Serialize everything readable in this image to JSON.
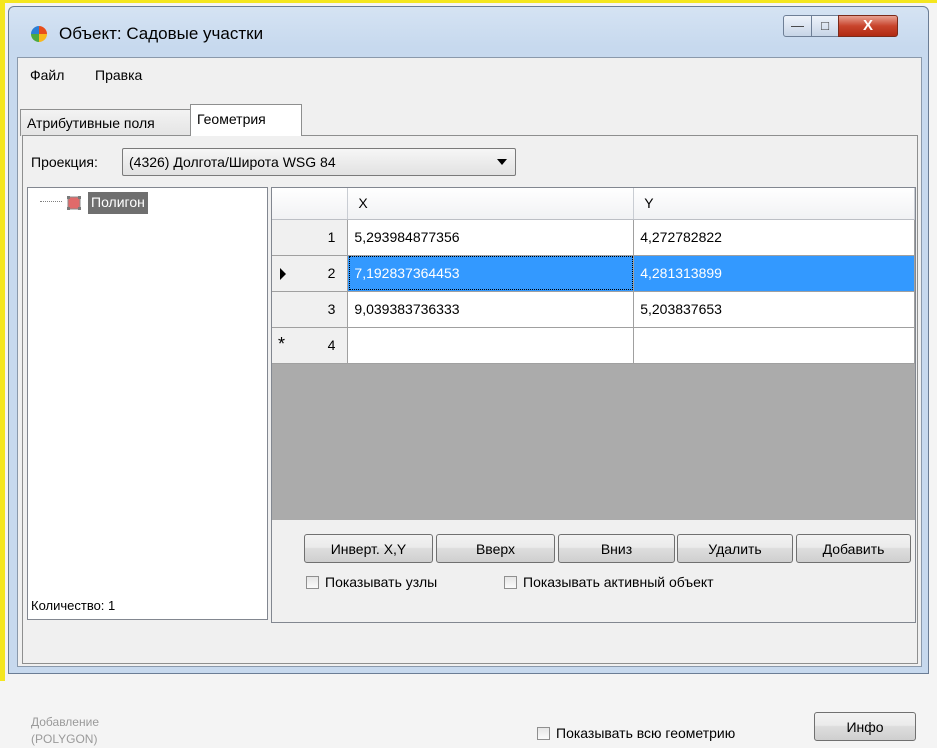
{
  "window": {
    "title": "Объект: Садовые участки",
    "controls": {
      "minimize": "—",
      "maximize": "□",
      "close": "X"
    }
  },
  "menu": {
    "file": "Файл",
    "edit": "Правка"
  },
  "tabs": [
    {
      "label": "Атрибутивные поля"
    },
    {
      "label": "Геометрия"
    }
  ],
  "projection": {
    "label": "Проекция:",
    "value": "(4326) Долгота/Широта WSG 84"
  },
  "tree": {
    "node_label": "Полигон",
    "count_label": "Количество: 1"
  },
  "grid": {
    "columns": [
      "X",
      "Y"
    ],
    "rows": [
      {
        "num": "1",
        "x": "5,293984877356",
        "y": "4,272782822"
      },
      {
        "num": "2",
        "x": "7,192837364453",
        "y": "4,281313899"
      },
      {
        "num": "3",
        "x": "9,039383736333",
        "y": "5,203837653"
      },
      {
        "num": "4",
        "x": "",
        "y": ""
      }
    ],
    "new_row_marker": "*"
  },
  "buttons": {
    "invert": "Инверт. X,Y",
    "up": "Вверх",
    "down": "Вниз",
    "delete": "Удалить",
    "add": "Добавить",
    "info": "Инфо"
  },
  "checkboxes": {
    "show_nodes": "Показывать узлы",
    "show_active": "Показывать активный объект",
    "show_all": "Показывать всю геометрию"
  },
  "status": {
    "line1": "Добавление",
    "line2": "(POLYGON)"
  }
}
